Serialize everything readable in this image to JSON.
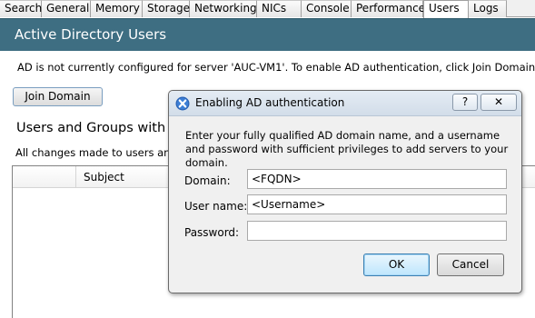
{
  "tabs": [
    {
      "label": "Search"
    },
    {
      "label": "General"
    },
    {
      "label": "Memory"
    },
    {
      "label": "Storage"
    },
    {
      "label": "Networking"
    },
    {
      "label": "NICs"
    },
    {
      "label": "Console"
    },
    {
      "label": "Performance"
    },
    {
      "label": "Users",
      "active": true
    },
    {
      "label": "Logs"
    }
  ],
  "header": {
    "title": "Active Directory Users",
    "color": "#3e6e82"
  },
  "main": {
    "info_text": "AD is not currently configured for server 'AUC-VM1'. To enable AD authentication, click Join Domain.",
    "join_button": "Join Domain",
    "section_title": "Users and Groups with Ac",
    "changes_text": "All changes made to users and g",
    "grid": {
      "columns": [
        "",
        "Subject"
      ]
    }
  },
  "dialog": {
    "title": "Enabling AD authentication",
    "help_label": "?",
    "close_label": "✕",
    "description": "Enter your fully qualified AD domain name, and a username and password with sufficient privileges to add servers to your domain.",
    "fields": {
      "domain": {
        "label": "Domain:",
        "value": "<FQDN>"
      },
      "username": {
        "label": "User name:",
        "value": "<Username>"
      },
      "password": {
        "label": "Password:",
        "value": ""
      }
    },
    "ok_button": "OK",
    "cancel_button": "Cancel"
  }
}
